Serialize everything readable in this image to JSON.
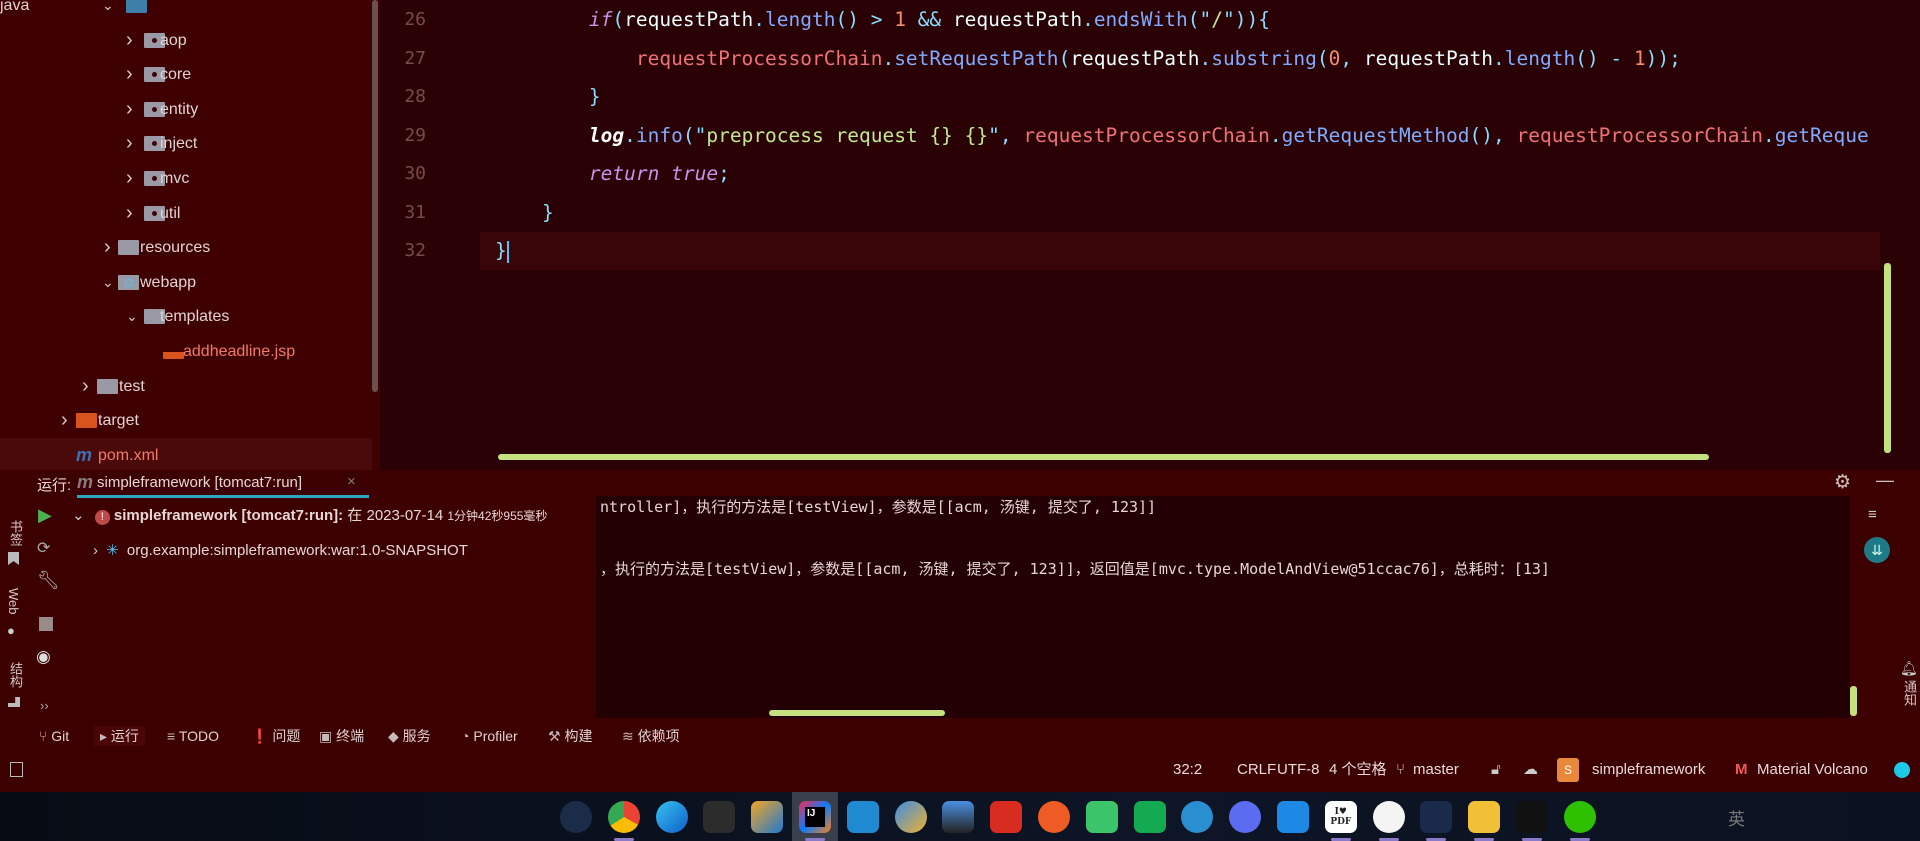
{
  "project_tree": {
    "items": [
      {
        "label": "java",
        "icon": "folder-source",
        "expanded": true
      },
      {
        "label": "aop",
        "icon": "package"
      },
      {
        "label": "core",
        "icon": "package"
      },
      {
        "label": "entity",
        "icon": "package"
      },
      {
        "label": "inject",
        "icon": "package"
      },
      {
        "label": "mvc",
        "icon": "package"
      },
      {
        "label": "util",
        "icon": "package"
      },
      {
        "label": "resources",
        "icon": "resources-folder"
      },
      {
        "label": "webapp",
        "icon": "web-folder",
        "expanded": true
      },
      {
        "label": "templates",
        "icon": "folder",
        "expanded": true
      },
      {
        "label": "addheadline.jsp",
        "icon": "jsp-file"
      },
      {
        "label": "test",
        "icon": "folder"
      },
      {
        "label": "target",
        "icon": "excluded-folder"
      },
      {
        "label": "pom.xml",
        "icon": "maven-file"
      }
    ]
  },
  "editor": {
    "lines": [
      {
        "num": "26",
        "tokens": [
          [
            "        ",
            "v"
          ],
          [
            "if",
            "k"
          ],
          [
            "(",
            "p"
          ],
          [
            "requestPath",
            "v"
          ],
          [
            ".",
            "p"
          ],
          [
            "length",
            "m"
          ],
          [
            "() > ",
            "p"
          ],
          [
            "1",
            "n"
          ],
          [
            " && ",
            "p"
          ],
          [
            "requestPath",
            "v"
          ],
          [
            ".",
            "p"
          ],
          [
            "endsWith",
            "m"
          ],
          [
            "(\"",
            "p"
          ],
          [
            "/",
            "s"
          ],
          [
            "\")){",
            "p"
          ]
        ]
      },
      {
        "num": "27",
        "tokens": [
          [
            "            ",
            "v"
          ],
          [
            "requestProcessorChain",
            "f"
          ],
          [
            ".",
            "p"
          ],
          [
            "setRequestPath",
            "m"
          ],
          [
            "(",
            "p"
          ],
          [
            "requestPath",
            "v"
          ],
          [
            ".",
            "p"
          ],
          [
            "substring",
            "m"
          ],
          [
            "(",
            "p"
          ],
          [
            "0",
            "n"
          ],
          [
            ", ",
            "p"
          ],
          [
            "requestPath",
            "v"
          ],
          [
            ".",
            "p"
          ],
          [
            "length",
            "m"
          ],
          [
            "() - ",
            "p"
          ],
          [
            "1",
            "n"
          ],
          [
            "));",
            "p"
          ]
        ]
      },
      {
        "num": "28",
        "tokens": [
          [
            "        ",
            "v"
          ],
          [
            "}",
            "p"
          ]
        ]
      },
      {
        "num": "29",
        "tokens": [
          [
            "        ",
            "v"
          ],
          [
            "log",
            "l"
          ],
          [
            ".",
            "p"
          ],
          [
            "info",
            "m"
          ],
          [
            "(\"",
            "p"
          ],
          [
            "preprocess request {} {}",
            "s"
          ],
          [
            "\", ",
            "p"
          ],
          [
            "requestProcessorChain",
            "f"
          ],
          [
            ".",
            "p"
          ],
          [
            "getRequestMethod",
            "m"
          ],
          [
            "(), ",
            "p"
          ],
          [
            "requestProcessorChain",
            "f"
          ],
          [
            ".",
            "p"
          ],
          [
            "getReque",
            "m"
          ]
        ]
      },
      {
        "num": "30",
        "tokens": [
          [
            "        ",
            "v"
          ],
          [
            "return true",
            "k"
          ],
          [
            ";",
            "p"
          ]
        ]
      },
      {
        "num": "31",
        "tokens": [
          [
            "    ",
            "v"
          ],
          [
            "}",
            "p"
          ]
        ]
      },
      {
        "num": "32",
        "tokens": [
          [
            "}",
            "p"
          ]
        ]
      }
    ],
    "cursor": "32:2"
  },
  "run_panel": {
    "label": "运行:",
    "tab": "simpleframework [tomcat7:run]",
    "tree": [
      {
        "bold": "simpleframework [tomcat7:run]:",
        "rest": " 在 2023-07-14 ",
        "time": "1分钟42秒955毫秒",
        "status": "error"
      },
      {
        "label": "org.example:simpleframework:war:1.0-SNAPSHOT",
        "status": "running"
      }
    ],
    "console": [
      "ntroller]，执行的方法是[testView]，参数是[[acm, 汤键, 提交了, 123]]",
      "，执行的方法是[testView]，参数是[[acm, 汤键, 提交了, 123]]，返回值是[mvc.type.ModelAndView@51ccac76]，总耗时：[13]"
    ]
  },
  "left_strip": {
    "bookmarks": "书签",
    "web": "Web",
    "structure": "结构"
  },
  "right_strip": {
    "notifications": "通知"
  },
  "tool_windows": [
    {
      "label": "Git",
      "icon": "git-branch-icon"
    },
    {
      "label": "运行",
      "icon": "run-icon"
    },
    {
      "label": "TODO",
      "icon": "list-icon"
    },
    {
      "label": "问题",
      "icon": "problems-icon"
    },
    {
      "label": "终端",
      "icon": "terminal-icon"
    },
    {
      "label": "服务",
      "icon": "services-icon"
    },
    {
      "label": "Profiler",
      "icon": "profiler-icon"
    },
    {
      "label": "构建",
      "icon": "hammer-icon"
    },
    {
      "label": "依赖项",
      "icon": "layers-icon"
    }
  ],
  "status_bar": {
    "position": "32:2",
    "line_sep": "CRLF",
    "encoding": "UTF-8",
    "indent": "4 个空格",
    "branch": "master",
    "project_badge": "S",
    "project": "simpleframework",
    "theme_badge": "M",
    "theme": "Material Volcano"
  },
  "taskbar": {
    "apps": [
      "steam",
      "chrome",
      "edge",
      "terminal",
      "app-orange-blue",
      "intellij-idea",
      "vscode",
      "navicat",
      "remote-desktop",
      "redis",
      "postman",
      "green-bird-app",
      "mongodb-compass",
      "b-app",
      "circle-app",
      "blue-bird-app",
      "ilovepdf",
      "dots-app",
      "cat-app",
      "file-explorer",
      "black-app",
      "wechat"
    ],
    "active": "intellij-idea",
    "pdf_label": "I♥ PDF",
    "ime": "英"
  },
  "colors": {
    "background": "#3e0000",
    "editor": "#2a0104",
    "console": "#220004",
    "accent": "#c5e07c",
    "taskbar": "#0d1526"
  }
}
